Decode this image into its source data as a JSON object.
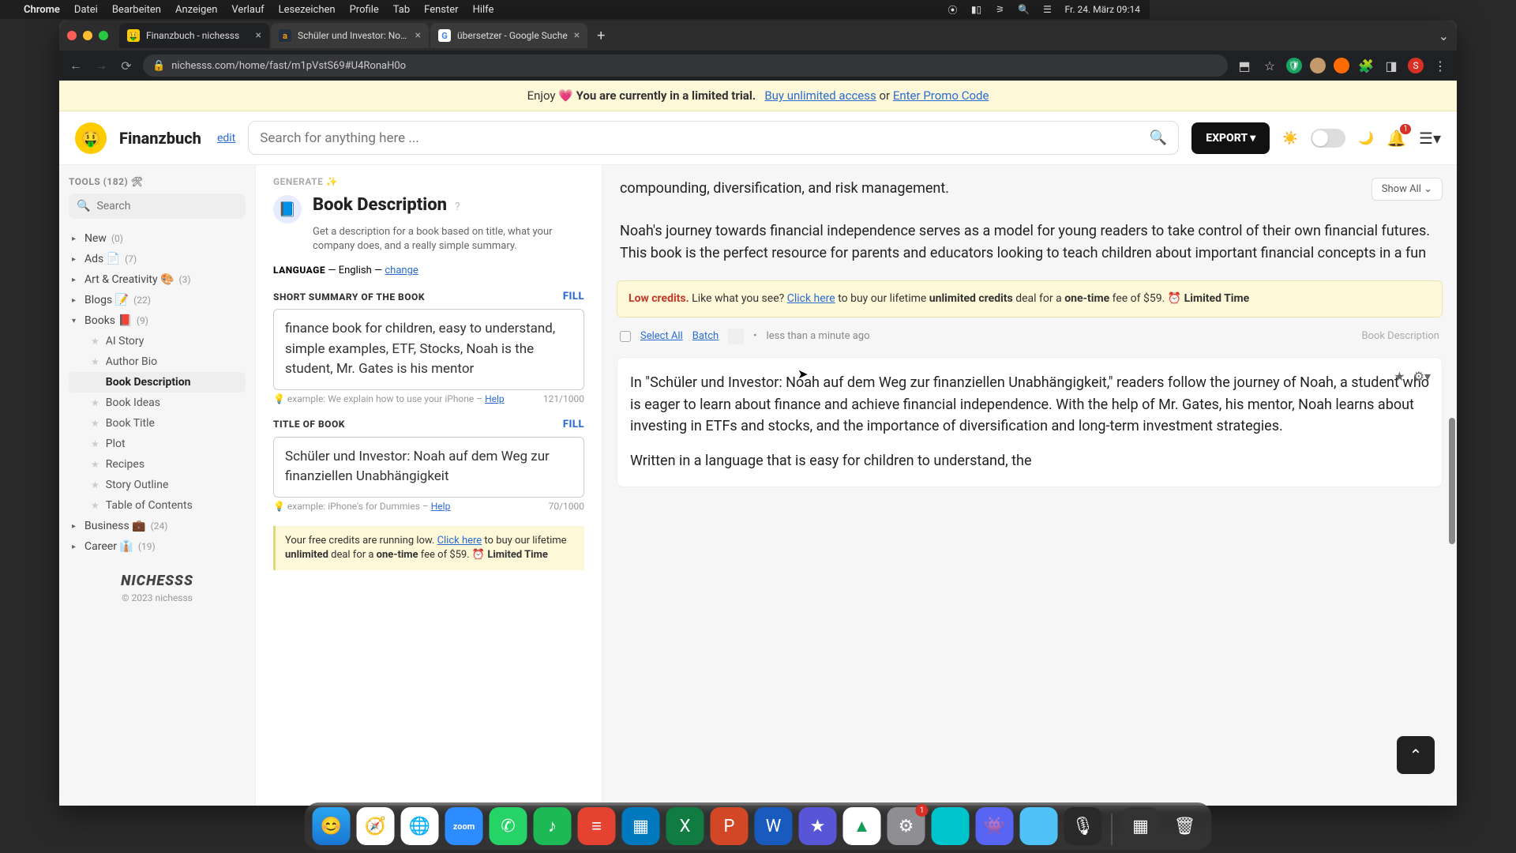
{
  "menubar": {
    "items": [
      "Chrome",
      "Datei",
      "Bearbeiten",
      "Anzeigen",
      "Verlauf",
      "Lesezeichen",
      "Profile",
      "Tab",
      "Fenster",
      "Hilfe"
    ],
    "clock": "Fr. 24. März 09:14"
  },
  "tabs": [
    {
      "label": "Finanzbuch - nichesss",
      "favicon": "🤑"
    },
    {
      "label": "Schüler und Investor: Noah au",
      "favicon": "a"
    },
    {
      "label": "übersetzer - Google Suche",
      "favicon": "G"
    }
  ],
  "url": "nichesss.com/home/fast/m1pVstS69#U4RonaH0o",
  "banner": {
    "pre": "Enjoy 💗 ",
    "bold": "You are currently in a limited trial.",
    "buy": "Buy unlimited access",
    "or": " or ",
    "promo": "Enter Promo Code"
  },
  "header": {
    "project": "Finanzbuch",
    "edit": "edit",
    "search_placeholder": "Search for anything here ...",
    "export": "EXPORT",
    "bell_badge": "1"
  },
  "sidebar": {
    "tools_label": "TOOLS (182) 🛠",
    "search_placeholder": "Search",
    "cats": [
      {
        "name": "New",
        "count": "(0)",
        "caret": "▸"
      },
      {
        "name": "Ads 📄",
        "count": "(7)",
        "caret": "▸"
      },
      {
        "name": "Art & Creativity 🎨",
        "count": "(3)",
        "caret": "▸"
      },
      {
        "name": "Blogs 📝",
        "count": "(22)",
        "caret": "▸"
      },
      {
        "name": "Books 📕",
        "count": "(9)",
        "caret": "▾"
      }
    ],
    "book_items": [
      "AI Story",
      "Author Bio",
      "Book Description",
      "Book Ideas",
      "Book Title",
      "Plot",
      "Recipes",
      "Story Outline",
      "Table of Contents"
    ],
    "selected": "Book Description",
    "cats2": [
      {
        "name": "Business 💼",
        "count": "(24)",
        "caret": "▸"
      },
      {
        "name": "Career 👔",
        "count": "(19)",
        "caret": "▸"
      }
    ],
    "brand": "NICHESSS",
    "copyright": "© 2023 nichesss"
  },
  "center": {
    "generate": "GENERATE ✨",
    "tool_title": "Book Description",
    "tool_sub": "Get a description for a book based on title, what your company does, and a really simple summary.",
    "lang_label": "LANGUAGE",
    "lang_sep": " — English — ",
    "lang_change": "change",
    "summary_label": "SHORT SUMMARY OF THE BOOK",
    "fill": "FILL",
    "summary_value": "finance book for children, easy to understand, simple examples, ETF, Stocks, Noah is the student, Mr. Gates is his mentor",
    "summary_hint": "💡 example: We explain how to use your iPhone – ",
    "help": "Help",
    "summary_count": "121/1000",
    "title_label": "TITLE OF BOOK",
    "title_value": "Schüler und Investor: Noah auf dem Weg zur finanziellen Unabhängigkeit",
    "title_hint": "💡 example: iPhone's for Dummies – ",
    "title_count": "70/1000",
    "credits": {
      "pre": "Your free credits are running low. ",
      "link": "Click here",
      "mid": " to buy our lifetime ",
      "bold1": "unlimited",
      "mid2": " deal for a ",
      "bold2": "one-time",
      "mid3": " fee of $59. ⏰ ",
      "bold3": "Limited Time"
    }
  },
  "results": {
    "showall": "Show All",
    "para1": "compounding, diversification, and risk management.",
    "para2": "Noah's journey towards financial independence serves as a model for young readers to take control of their own financial futures. This book is the perfect resource for parents and educators looking to teach children about important financial concepts in a fun",
    "lowcredits": {
      "lc": "Low credits.",
      "pre": " Like what you see? ",
      "link": "Click here",
      "mid": " to buy our lifetime ",
      "b1": "unlimited credits",
      "mid2": " deal for a ",
      "b2": "one-time",
      "mid3": " fee of $59. ⏰ ",
      "b3": "Limited Time"
    },
    "meta": {
      "selectall": "Select All",
      "batch": "Batch",
      "time": "less than a minute ago",
      "tag": "Book Description"
    },
    "card1": "In \"Schüler und Investor: Noah auf dem Weg zur finanziellen Unabhängigkeit,\" readers follow the journey of Noah, a student who is eager to learn about finance and achieve financial independence. With the help of Mr. Gates, his mentor, Noah learns about investing in ETFs and stocks, and the importance of diversification and long-term investment strategies.",
    "card1b": "Written in a language that is easy for children to understand, the"
  },
  "dock": {
    "badge": "1"
  }
}
